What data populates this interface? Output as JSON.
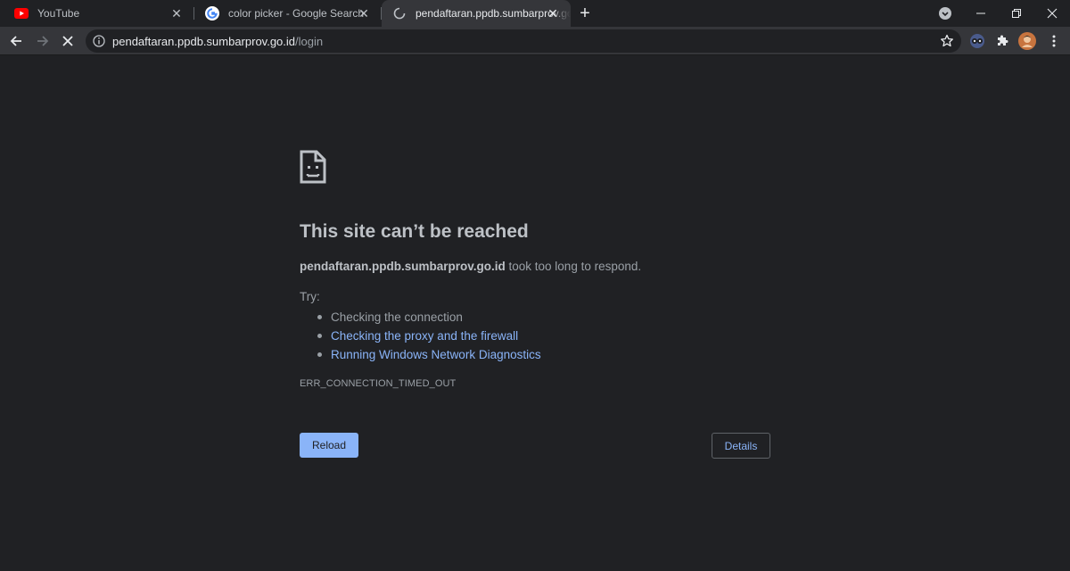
{
  "tabs": [
    {
      "title": "YouTube",
      "favicon": "youtube-icon",
      "state": "inactive"
    },
    {
      "title": "color picker - Google Search",
      "favicon": "google-icon",
      "state": "inactive"
    },
    {
      "title": "pendaftaran.ppdb.sumbarprov.go.id/login",
      "favicon": "loading-spinner-icon",
      "state": "active"
    }
  ],
  "omnibox": {
    "host": "pendaftaran.ppdb.sumbarprov.go.id",
    "path": "/login"
  },
  "error_page": {
    "icon": "sad-page-icon",
    "heading": "This site can’t be reached",
    "summary_host": "pendaftaran.ppdb.sumbarprov.go.id",
    "summary_rest": " took too long to respond.",
    "try_label": "Try:",
    "suggestions": [
      "Checking the connection",
      "Checking the proxy and the firewall",
      "Running Windows Network Diagnostics"
    ],
    "error_code": "ERR_CONNECTION_TIMED_OUT",
    "reload_label": "Reload",
    "details_label": "Details"
  },
  "colors": {
    "background": "#202124",
    "link": "#8ab4f8",
    "toolbar": "#35363a"
  }
}
